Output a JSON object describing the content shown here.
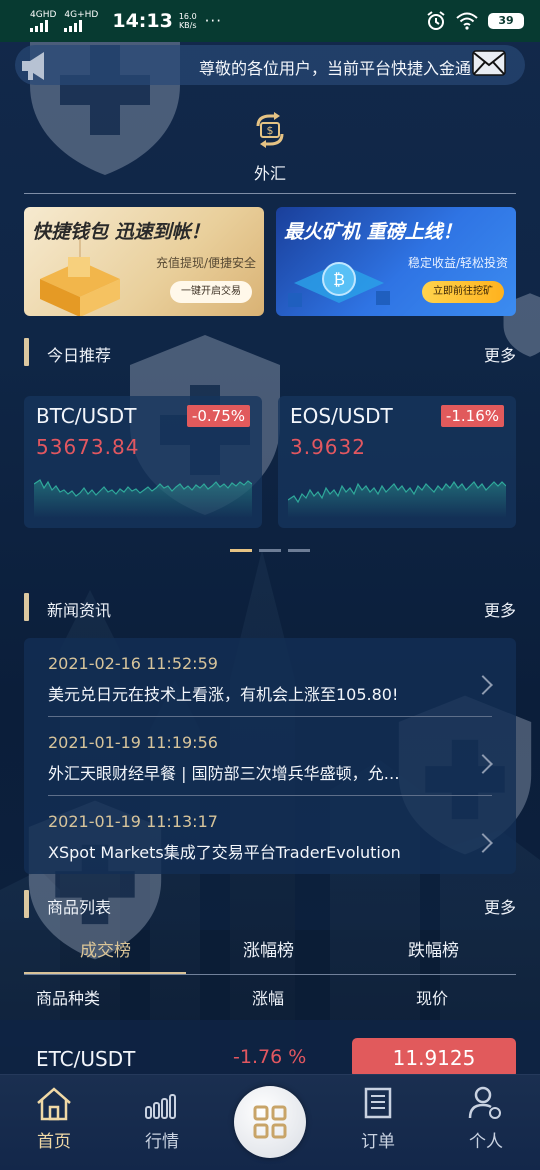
{
  "status_bar": {
    "net1": "4GHD",
    "net2": "4G+HD",
    "time": "14:13",
    "speed_value": "16.0",
    "speed_unit": "KB/s",
    "dots": "···",
    "battery": "39"
  },
  "notice": {
    "text": "尊敬的各位用户，当前平台快捷入金通"
  },
  "forex": {
    "label": "外汇"
  },
  "banners": [
    {
      "title": "快捷钱包 迅速到帐！",
      "subtitle": "充值提现/便捷安全",
      "button": "一键开启交易"
    },
    {
      "title": "最火矿机 重磅上线！",
      "subtitle": "稳定收益/轻松投资",
      "button": "立即前往挖矿"
    }
  ],
  "today": {
    "title": "今日推荐",
    "more": "更多"
  },
  "markets": [
    {
      "pair": "BTC/USDT",
      "change": "-0.75%",
      "price": "53673.84"
    },
    {
      "pair": "EOS/USDT",
      "change": "-1.16%",
      "price": "3.9632"
    }
  ],
  "news_section": {
    "title": "新闻资讯",
    "more": "更多"
  },
  "news": [
    {
      "date": "2021-02-16 11:52:59",
      "text": "美元兑日元在技术上看涨，有机会上涨至105.80!"
    },
    {
      "date": "2021-01-19 11:19:56",
      "text": "外汇天眼财经早餐 | 国防部三次增兵华盛顿，允…"
    },
    {
      "date": "2021-01-19 11:13:17",
      "text": "XSpot Markets集成了交易平台TraderEvolution"
    }
  ],
  "products": {
    "title": "商品列表",
    "more": "更多",
    "tabs": [
      "成交榜",
      "涨幅榜",
      "跌幅榜"
    ],
    "columns": [
      "商品种类",
      "涨幅",
      "现价"
    ],
    "rows": [
      {
        "pair": "ETC/USDT",
        "change": "-1.76 %",
        "price": "11.9125"
      }
    ]
  },
  "nav": {
    "home": "首页",
    "market": "行情",
    "orders": "订单",
    "profile": "个人"
  },
  "colors": {
    "status_bar": "#073a31",
    "accent_gold": "#dcc8a0",
    "down_red": "#e15a5c",
    "chart_line": "#2fa89a"
  }
}
